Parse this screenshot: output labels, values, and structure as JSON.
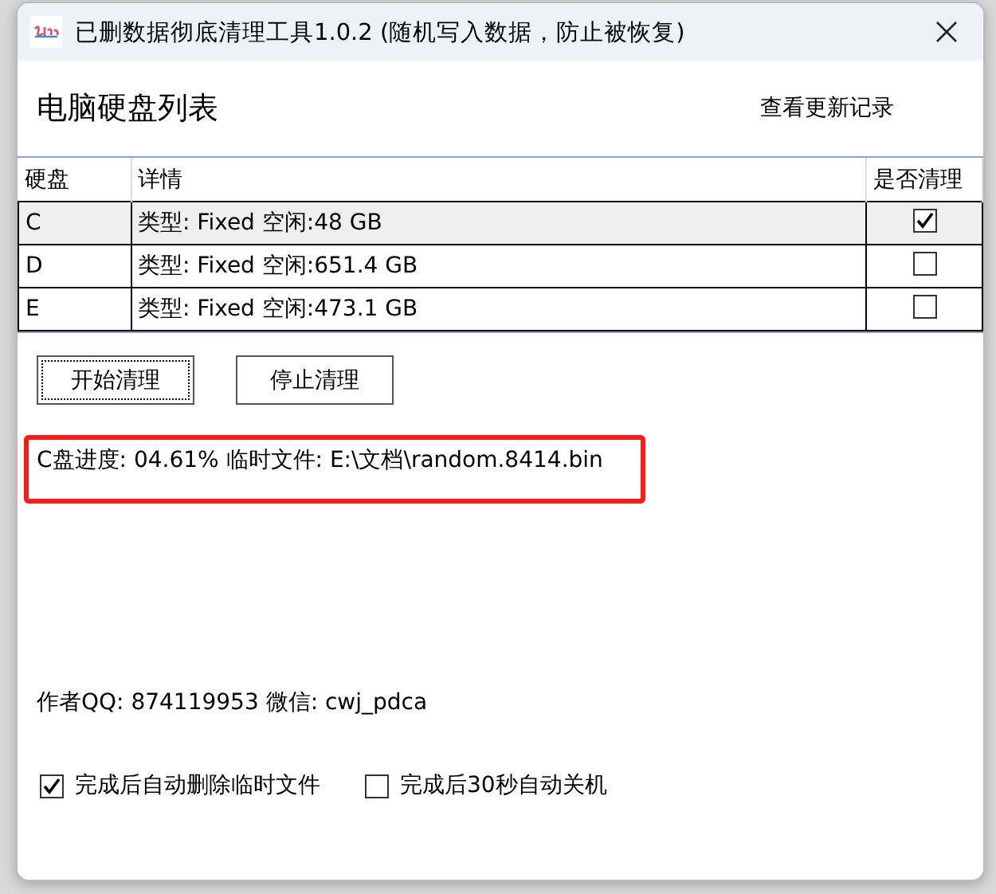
{
  "window": {
    "title": "已删数据彻底清理工具1.0.2 (随机写入数据，防止被恢复)"
  },
  "heading": "电脑硬盘列表",
  "update_link": "查看更新记录",
  "table": {
    "columns": [
      "硬盘",
      "详情",
      "是否清理"
    ],
    "rows": [
      {
        "drive": "C",
        "details": "类型: Fixed 空闲:48 GB",
        "checked": true,
        "selected": true
      },
      {
        "drive": "D",
        "details": "类型: Fixed 空闲:651.4 GB",
        "checked": false,
        "selected": false
      },
      {
        "drive": "E",
        "details": "类型: Fixed 空闲:473.1 GB",
        "checked": false,
        "selected": false
      }
    ]
  },
  "buttons": [
    {
      "label": "开始清理",
      "focused": true
    },
    {
      "label": "停止清理",
      "focused": false
    }
  ],
  "status": "C盘进度: 04.61% 临时文件: E:\\文档\\random.8414.bin",
  "author": "作者QQ: 874119953  微信: cwj_pdca",
  "options": [
    {
      "label": "完成后自动删除临时文件",
      "checked": true
    },
    {
      "label": "完成后30秒自动关机",
      "checked": false
    }
  ]
}
